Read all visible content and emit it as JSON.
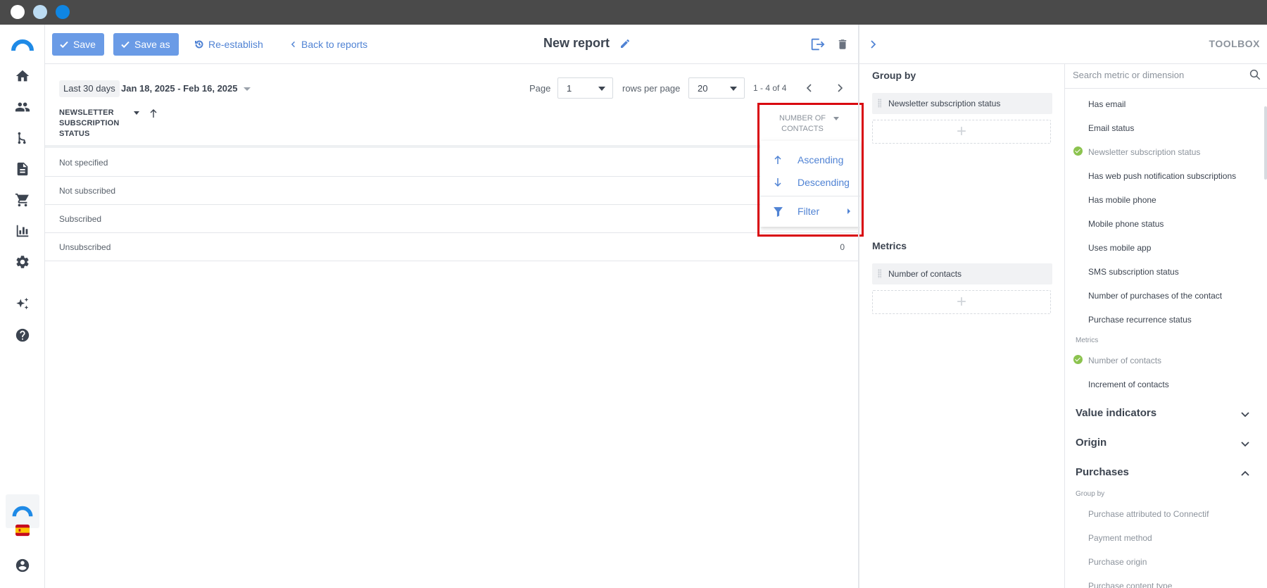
{
  "toolbar": {
    "save_label": "Save",
    "save_as_label": "Save as",
    "reestablish_label": "Re-establish",
    "back_label": "Back to reports",
    "report_title": "New report"
  },
  "filters": {
    "period_chip": "Last 30 days",
    "date_range": "Jan 18, 2025 - Feb 16, 2025",
    "page_label": "Page",
    "page_value": "1",
    "rows_label": "rows per page",
    "rows_value": "20",
    "range_text": "1 - 4 of 4"
  },
  "table": {
    "col_left": "NEWSLETTER SUBSCRIPTION STATUS",
    "col_right": "NUMBER OF CONTACTS",
    "rows": [
      {
        "label": "Not specified",
        "value": ""
      },
      {
        "label": "Not subscribed",
        "value": ""
      },
      {
        "label": "Subscribed",
        "value": ""
      },
      {
        "label": "Unsubscribed",
        "value": "0"
      }
    ]
  },
  "column_menu": {
    "ascending": "Ascending",
    "descending": "Descending",
    "filter": "Filter"
  },
  "panel": {
    "toolbox_title": "TOOLBOX",
    "group_by_title": "Group by",
    "group_by_items": [
      "Newsletter subscription status"
    ],
    "metrics_title": "Metrics",
    "metrics_items": [
      "Number of contacts"
    ],
    "dropzone_glyph": "+"
  },
  "toolbox": {
    "search_placeholder": "Search metric or dimension",
    "dimensions": [
      {
        "label": "Has email",
        "selected": false
      },
      {
        "label": "Email status",
        "selected": false
      },
      {
        "label": "Newsletter subscription status",
        "selected": true
      },
      {
        "label": "Has web push notification subscriptions",
        "selected": false
      },
      {
        "label": "Has mobile phone",
        "selected": false
      },
      {
        "label": "Mobile phone status",
        "selected": false
      },
      {
        "label": "Uses mobile app",
        "selected": false
      },
      {
        "label": "SMS subscription status",
        "selected": false
      },
      {
        "label": "Number of purchases of the contact",
        "selected": false
      },
      {
        "label": "Purchase recurrence status",
        "selected": false
      }
    ],
    "metrics_label": "Metrics",
    "metrics": [
      {
        "label": "Number of contacts",
        "selected": true
      },
      {
        "label": "Increment of contacts",
        "selected": false
      }
    ],
    "sections": [
      {
        "label": "Value indicators",
        "expanded": false
      },
      {
        "label": "Origin",
        "expanded": false
      },
      {
        "label": "Purchases",
        "expanded": true
      }
    ],
    "purchases_group_label": "Group by",
    "purchases_items": [
      "Purchase attributed to Connectif",
      "Payment method",
      "Purchase origin",
      "Purchase content type"
    ]
  },
  "colors": {
    "primary": "#6a9be6",
    "link": "#5083d4",
    "highlight": "#d9060f",
    "check": "#8cc34f"
  }
}
